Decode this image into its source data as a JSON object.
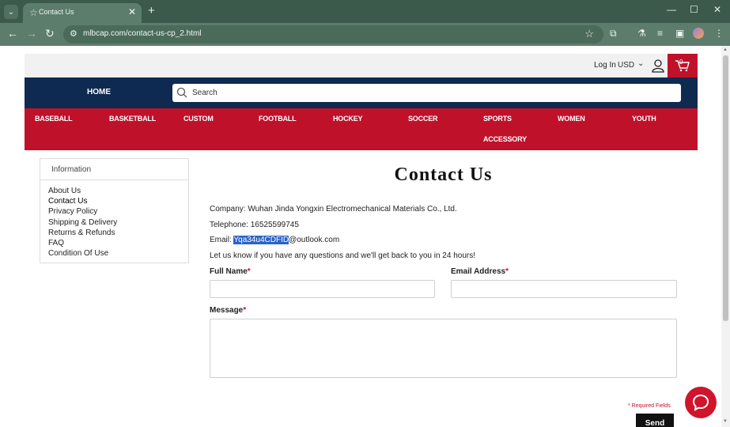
{
  "browser": {
    "tab_title": "Contact Us",
    "url": "mlbcap.com/contact-us-cp_2.html"
  },
  "header": {
    "login": "Log In",
    "currency": "USD",
    "cart_count": "0"
  },
  "nav": {
    "home": "HOME",
    "search_placeholder": "Search",
    "categories": [
      "BASEBALL",
      "BASKETBALL",
      "CUSTOM",
      "FOOTBALL",
      "HOCKEY",
      "SOCCER",
      "SPORTS",
      "WOMEN",
      "YOUTH",
      "ACCESSORY"
    ]
  },
  "sidebar": {
    "heading": "Information",
    "items": [
      "About Us",
      "Contact Us",
      "Privacy Policy",
      "Shipping & Delivery",
      "Returns & Refunds",
      "FAQ",
      "Condition Of Use"
    ]
  },
  "content": {
    "title": "Contact Us",
    "company": "Company: Wuhan Jinda Yongxin Electromechanical Materials Co., Ltd.",
    "telephone": "Telephone: 16525599745",
    "email_label": "Email: ",
    "email_selected": "Yqa34u4CDFID",
    "email_domain": "@outlook.com",
    "note": "Let us know if you have any questions and we'll get back to you in 24 hours!"
  },
  "form": {
    "full_name_label": "Full Name",
    "email_label": "Email Address",
    "message_label": "Message",
    "required_mark": "*",
    "required_note": "* Required Fields",
    "send": "Send"
  },
  "colors": {
    "brand_red": "#c0112b",
    "navy": "#0e2a50",
    "browser_green": "#5c7d6b"
  }
}
